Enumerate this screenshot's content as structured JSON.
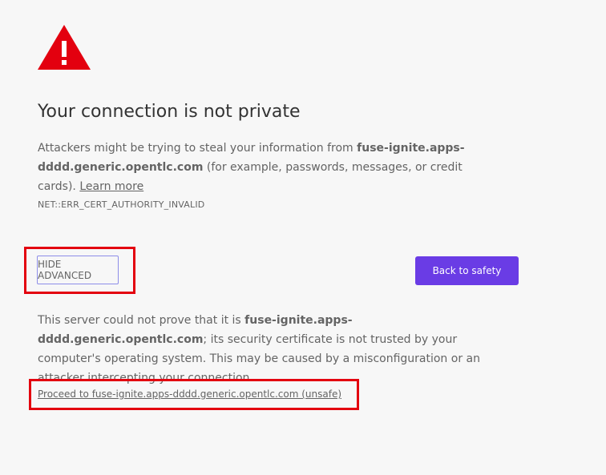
{
  "icon": {
    "name": "warning-triangle-icon",
    "color": "#e3000f"
  },
  "heading": "Your connection is not private",
  "main_message": {
    "text_before": "Attackers might be trying to steal your information from ",
    "host": "fuse-ignite.apps-dddd.generic.opentlc.com",
    "text_after": " (for example, passwords, messages, or credit cards). ",
    "learn_more": "Learn more"
  },
  "error_code": "NET::ERR_CERT_AUTHORITY_INVALID",
  "buttons": {
    "hide_advanced": "HIDE ADVANCED",
    "back_to_safety": "Back to safety"
  },
  "details": {
    "text_before": "This server could not prove that it is ",
    "host": "fuse-ignite.apps-dddd.generic.opentlc.com",
    "text_after": "; its security certificate is not trusted by your computer's operating system. This may be caused by a misconfiguration or an attacker intercepting your connection."
  },
  "proceed_link": "Proceed to fuse-ignite.apps-dddd.generic.opentlc.com (unsafe)",
  "colors": {
    "accent": "#6a3ce5",
    "annotation": "#e3000f",
    "background": "#f7f7f7"
  }
}
